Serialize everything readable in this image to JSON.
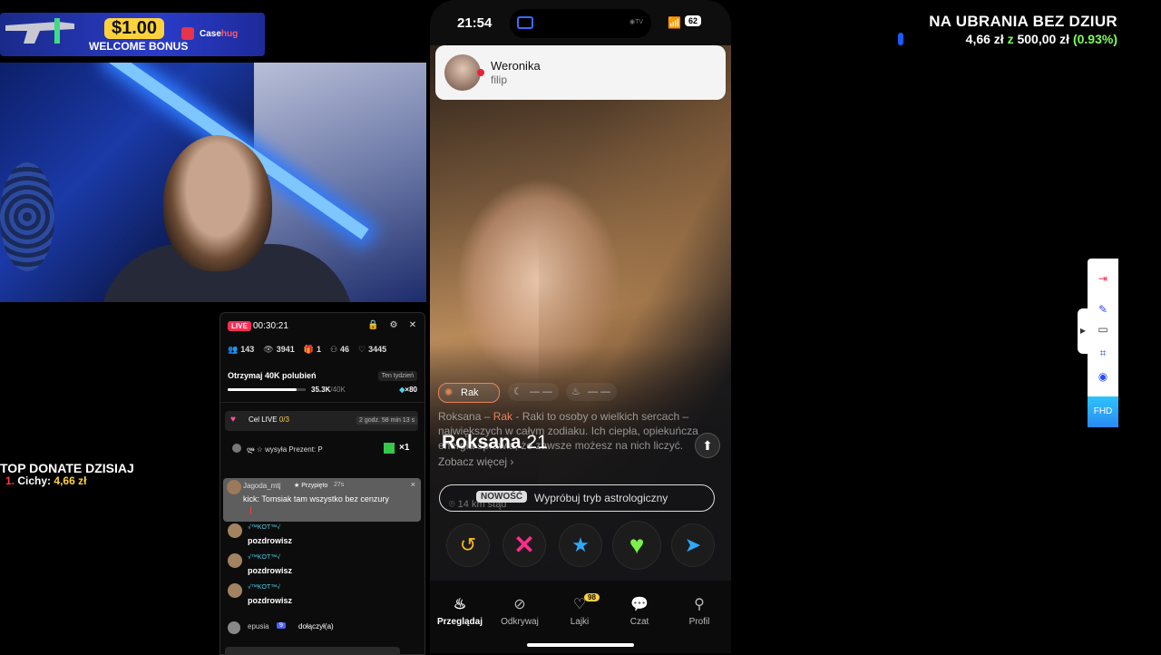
{
  "promo": {
    "amount": "$1.00",
    "welcome": "WELCOME BONUS",
    "brand_prefix": "Case",
    "brand_suffix": "hug"
  },
  "donate": {
    "title": "TOP DONATE DZISIAJ",
    "rank": "1.",
    "name": "Cichy:",
    "amount": "4,66 zł"
  },
  "goal": {
    "title": "NA UBRANIA BEZ DZIUR",
    "current": "4,66 zł",
    "z": "z",
    "target": "500,00 zł",
    "percent": "(0.93%)"
  },
  "live": {
    "badge": "LIVE",
    "timer": "00:30:21",
    "stats": {
      "viewers_joined": "143",
      "views": "3941",
      "gifts": "1",
      "new_followers": "46",
      "likes": "3445"
    },
    "goal_text": "Otrzymaj 40K polubień",
    "week_label": "Ten tydzień",
    "progress_current": "35.3K",
    "progress_target": "/40K",
    "progress_fraction": 0.8825,
    "coins": "×80",
    "cel": {
      "label": "Cel LIVE",
      "value": "0/3",
      "time": "2 godz. 58 min 13 s"
    },
    "gift": {
      "text": "ლ̶̶̶̶̶̶̶̶̶̶̶̶̶̶̶̶̶̶̶̶̶̶̶̶̶̶̶ ☆ wysyła Prezent: P",
      "count": "×1"
    },
    "pinned": {
      "user": "Jagoda_mtj",
      "pinned_label": "Przypięto",
      "age": "27s",
      "message": "kick: Tomsiak tam wszystko bez cenzury"
    },
    "chat": [
      {
        "user": "√™KOT™√",
        "message": "pozdrowisz"
      },
      {
        "user": "√™KOT™√",
        "message": "pozdrowisz"
      },
      {
        "user": "√™KOT™√",
        "message": "pozdrowisz"
      }
    ],
    "join": {
      "user": "epusia",
      "level": "9",
      "action": "dołączył(a)"
    }
  },
  "phone": {
    "time": "21:54",
    "battery": "62",
    "notification": {
      "name": "Weronika",
      "message": "filip"
    },
    "chips": {
      "sign": "Rak",
      "moon": "— —",
      "rising": "— —"
    },
    "description_name": "Roksana",
    "description_sign": "Rak",
    "description_text": "- Raki to osoby o wielkich sercach – największych w całym zodiaku. Ich ciepła, opiekuńcza energia sprawia, że zawsze możesz na nich liczyć.",
    "profile_name": "Roksana",
    "profile_age": "21",
    "see_more": "Zobacz więcej",
    "distance": "14 km stąd",
    "new_badge": "NOWOŚĆ",
    "astro_label": "Wypróbuj tryb astrologiczny",
    "tabs": [
      {
        "label": "Przeglądaj"
      },
      {
        "label": "Odkrywaj"
      },
      {
        "label": "Lajki",
        "count": "98"
      },
      {
        "label": "Czat"
      },
      {
        "label": "Profil"
      }
    ]
  },
  "tools": {
    "quality": "FHD"
  },
  "colors": {
    "accent_green": "#7cff5a",
    "tinder_pink": "#ff2d8a",
    "live_red": "#ff2d55"
  }
}
